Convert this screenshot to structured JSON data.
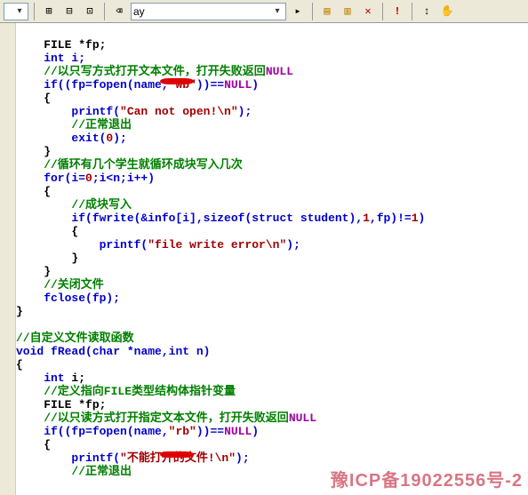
{
  "toolbar": {
    "dropdown1_value": "",
    "dropdown2_value": "ay",
    "icons": {
      "i1": "▾",
      "i2": "⊞",
      "i3": "⊟",
      "i4": "⊡",
      "i5": "⌫",
      "i6": "▤",
      "i7": "▥",
      "i8": "✕",
      "i9": "!",
      "i10": "↕",
      "i11": "✋"
    }
  },
  "code": {
    "l01": "    FILE *fp;",
    "l02": "    int i;",
    "l03a": "    //以只写方式打开文本文件，打开失败返回",
    "l03b": "NULL",
    "l04a": "    if((fp=fopen(name,",
    "l04b": "\"wb\"",
    "l04c": "))==",
    "l04d": "NULL",
    "l04e": ")",
    "l05": "    {",
    "l06a": "        printf(",
    "l06b": "\"Can not open!\\n\"",
    "l06c": ");",
    "l07": "        //正常退出",
    "l08a": "        exit(",
    "l08b": "0",
    "l08c": ");",
    "l09": "    }",
    "l10": "    //循环有几个学生就循环成块写入几次",
    "l11a": "    for(i=",
    "l11b": "0",
    "l11c": ";i<n;i++)",
    "l12": "    {",
    "l13": "        //成块写入",
    "l14a": "        if(fwrite(&info[i],",
    "l14b": "sizeof",
    "l14c": "(",
    "l14d": "struct",
    "l14e": " student),",
    "l14f": "1",
    "l14g": ",fp)!=",
    "l14h": "1",
    "l14i": ")",
    "l15": "        {",
    "l16a": "            printf(",
    "l16b": "\"file write error\\n\"",
    "l16c": ");",
    "l17": "        }",
    "l18": "    }",
    "l19": "    //关闭文件",
    "l20": "    fclose(fp);",
    "l21": "}",
    "l22": "",
    "l23": "//自定义文件读取函数",
    "l24a": "void",
    "l24b": " fRead(",
    "l24c": "char",
    "l24d": " *name,",
    "l24e": "int",
    "l24f": " n)",
    "l25": "{",
    "l26a": "    int",
    "l26b": " i;",
    "l27": "    //定义指向FILE类型结构体指针变量",
    "l28": "    FILE *fp;",
    "l29a": "    //以只读方式打开指定文本文件，打开失败返回",
    "l29b": "NULL",
    "l30a": "    if((fp=fopen(name,",
    "l30b": "\"rb\"",
    "l30c": "))==",
    "l30d": "NULL",
    "l30e": ")",
    "l31": "    {",
    "l32a": "        printf(",
    "l32b": "\"不能打开的文件!\\n\"",
    "l32c": ");",
    "l33": "        //正常退出"
  },
  "watermark": "豫ICP备19022556号-2"
}
